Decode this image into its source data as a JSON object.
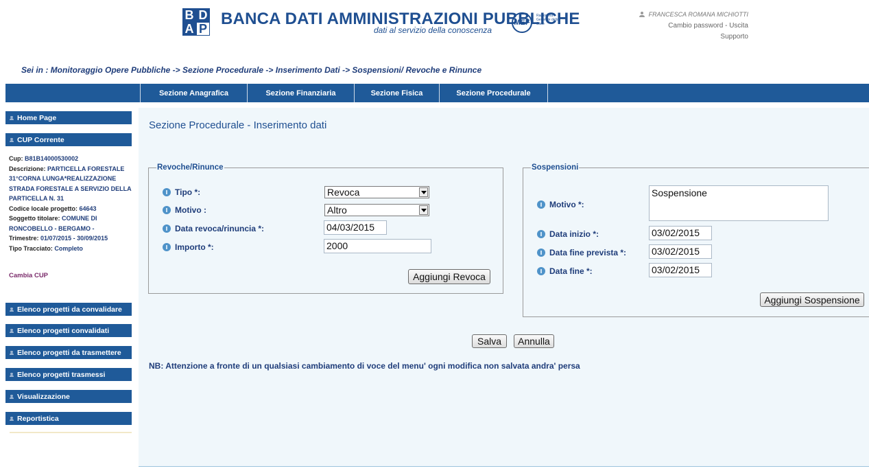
{
  "header": {
    "logo_top": "BD",
    "logo_bottom": "AP",
    "title": "BANCA DATI AMMINISTRAZIONI PUBBLICHE",
    "subtitle": "dati al servizio della conoscenza",
    "mef_logo": "MEF",
    "mef_side": "Ragioneria Generale dello Stato",
    "user_name": "FRANCESCA ROMANA MICHIOTTI",
    "user_links": "Cambio password - Uscita",
    "support": "Supporto"
  },
  "breadcrumb": "Sei in : Monitoraggio Opere Pubbliche -> Sezione Procedurale -> Inserimento Dati -> Sospensioni/ Revoche e Rinunce",
  "topnav": [
    "Sezione Anagrafica",
    "Sezione Finanziaria",
    "Sezione Fisica",
    "Sezione Procedurale"
  ],
  "sidebar": {
    "home": "Home Page",
    "cup_corrente": "CUP Corrente",
    "cup_label": "Cup:",
    "cup_value": "B81B14000530002",
    "descr_label": "Descrizione:",
    "descr_value": "PARTICELLA FORESTALE 31°CORNA LUNGA*REALIZZAZIONE STRADA FORESTALE A SERVIZIO DELLA PARTICELLA N. 31",
    "codice_label": "Codice locale progetto:",
    "codice_value": "64643",
    "soggetto_label": "Soggetto titolare:",
    "soggetto_value": "COMUNE DI RONCOBELLO - BERGAMO -",
    "trimestre_label": "Trimestre:",
    "trimestre_value": "01/07/2015 - 30/09/2015",
    "tracciato_label": "Tipo Tracciato:",
    "tracciato_value": "Completo",
    "cambia_cup": "Cambia CUP",
    "menu": [
      "Elenco progetti da convalidare",
      "Elenco progetti convalidati",
      "Elenco progetti da trasmettere",
      "Elenco progetti trasmessi",
      "Visualizzazione",
      "Reportistica"
    ]
  },
  "main": {
    "title": "Sezione Procedurale - Inserimento dati",
    "revoche": {
      "legend": "Revoche/Rinunce",
      "tipo_label": "Tipo *:",
      "tipo_value": "Revoca",
      "motivo_label": "Motivo :",
      "motivo_value": "Altro",
      "data_label": "Data revoca/rinuncia *:",
      "data_value": "04/03/2015",
      "importo_label": "Importo *:",
      "importo_value": "2000",
      "add_button": "Aggiungi Revoca"
    },
    "sospensioni": {
      "legend": "Sospensioni",
      "motivo_label": "Motivo *:",
      "motivo_value": "Sospensione",
      "inizio_label": "Data inizio *:",
      "inizio_value": "03/02/2015",
      "fine_prevista_label": "Data fine prevista *:",
      "fine_prevista_value": "03/02/2015",
      "fine_label": "Data fine *:",
      "fine_value": "03/02/2015",
      "add_button": "Aggiungi Sospensione"
    },
    "save_button": "Salva",
    "cancel_button": "Annulla",
    "note": "NB: Attenzione a fronte di un qualsiasi cambiamento di voce del menu' ogni modifica non salvata andra' persa"
  },
  "colors": {
    "nav_blue": "#1f5a99",
    "text_blue": "#1f3d7a",
    "panel_bg": "#f0f7fb"
  }
}
